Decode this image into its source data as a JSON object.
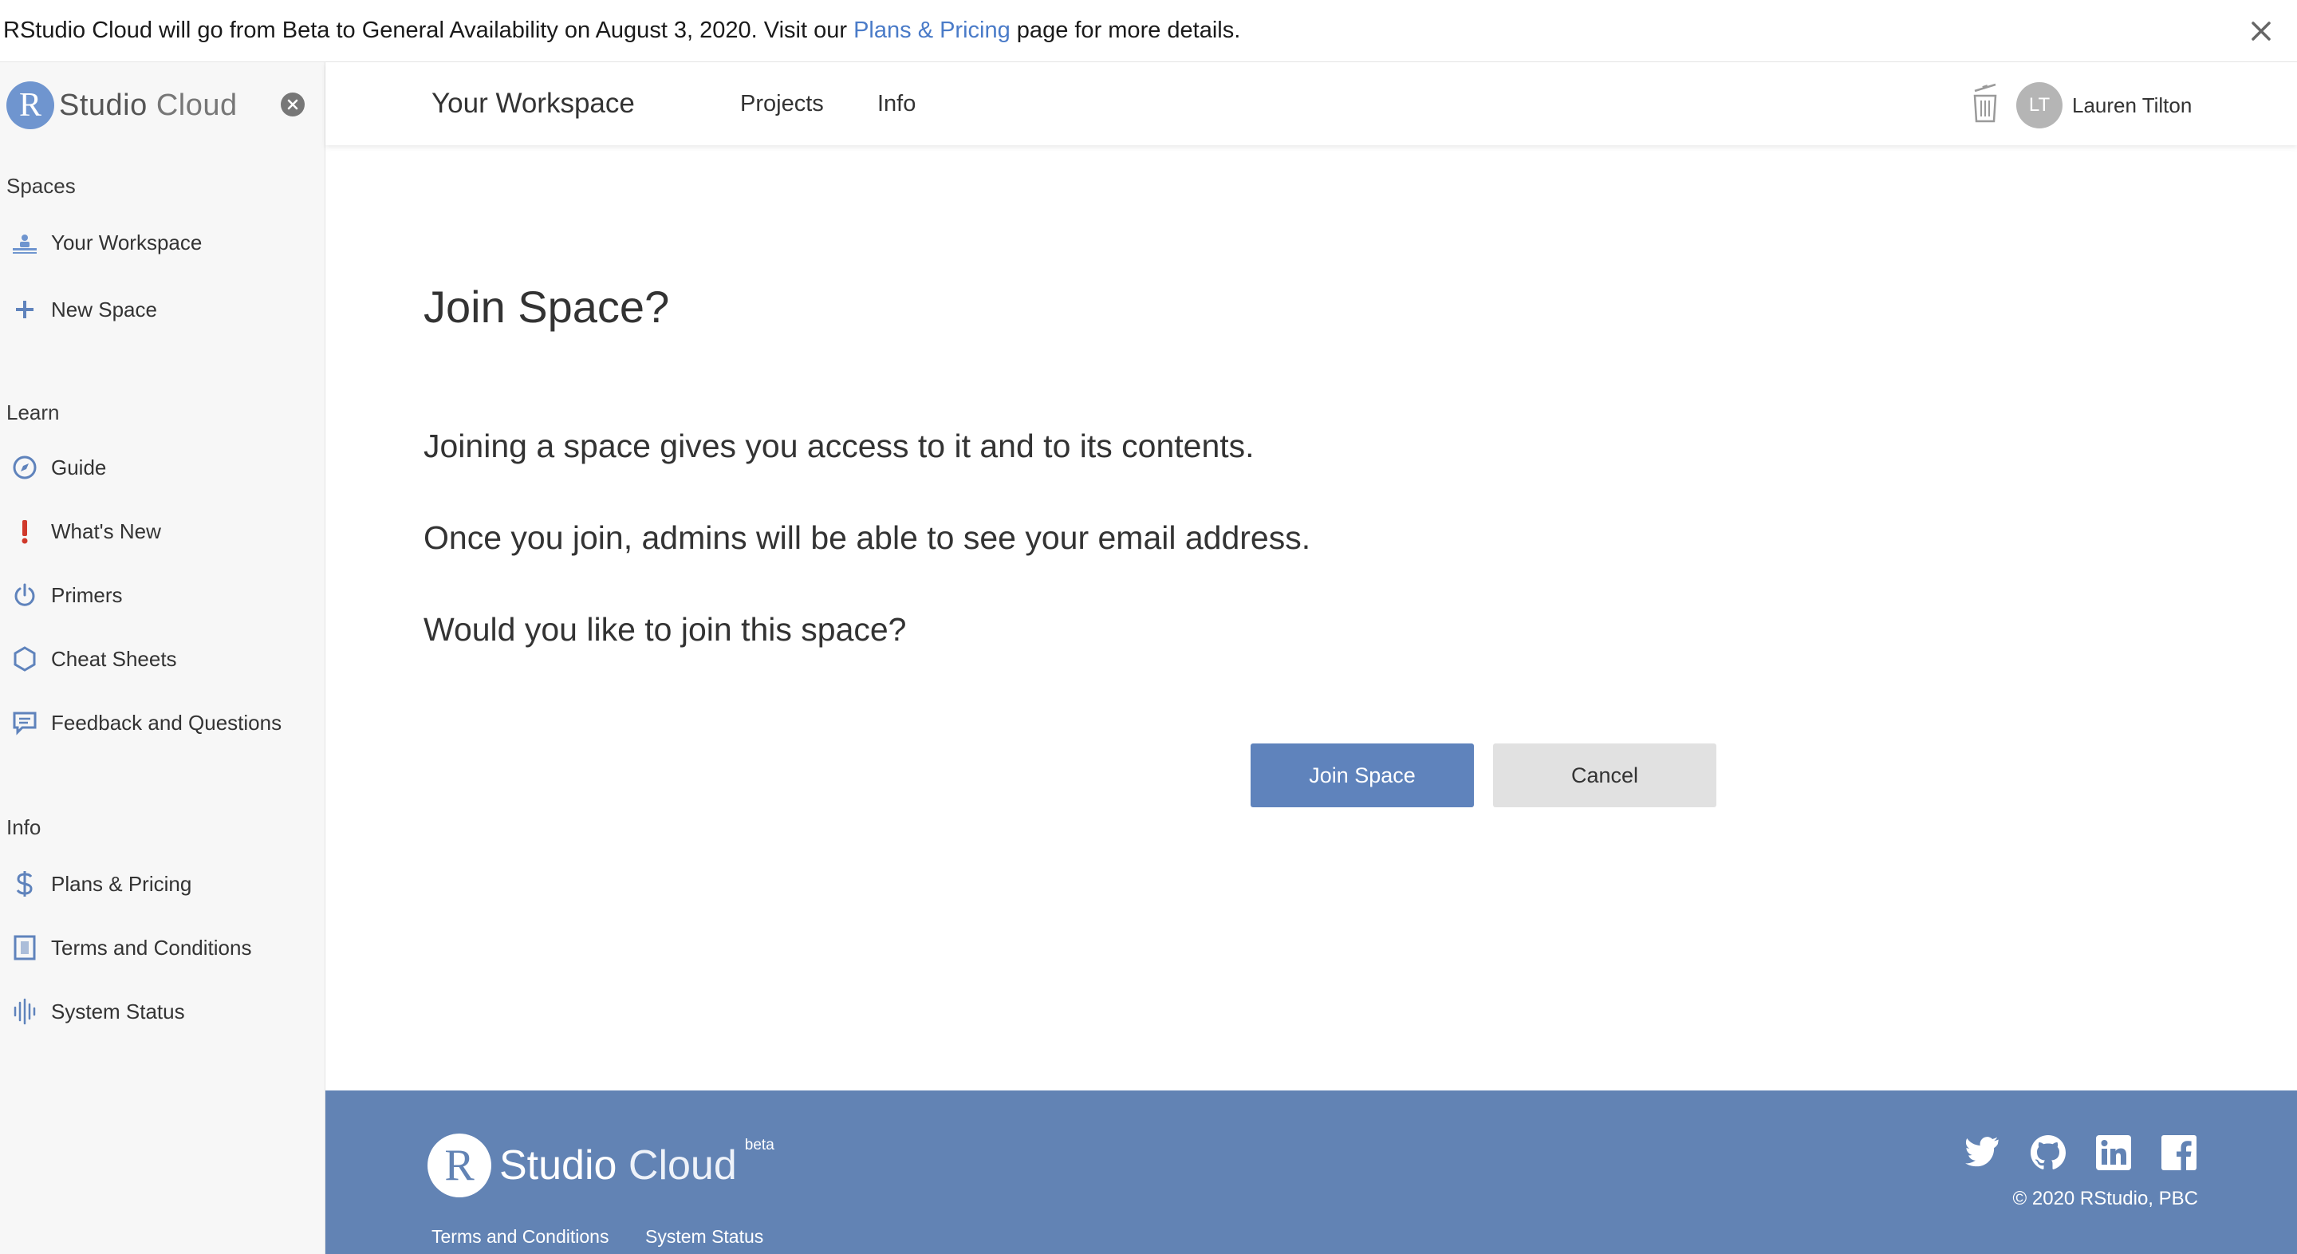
{
  "banner": {
    "text_before": "RStudio Cloud will go from Beta to General Availability on August 3, 2020. Visit our ",
    "link_text": "Plans & Pricing",
    "text_after": " page for more details."
  },
  "sidebar": {
    "logo": {
      "r": "R",
      "studio": "Studio",
      "cloud": "Cloud"
    },
    "sections": {
      "spaces": "Spaces",
      "learn": "Learn",
      "info": "Info"
    },
    "items": {
      "workspace": "Your Workspace",
      "new_space": "New Space",
      "guide": "Guide",
      "whats_new": "What's New",
      "primers": "Primers",
      "cheat_sheets": "Cheat Sheets",
      "feedback": "Feedback and Questions",
      "plans": "Plans & Pricing",
      "terms": "Terms and Conditions",
      "status": "System Status"
    }
  },
  "header": {
    "title": "Your Workspace",
    "tabs": {
      "projects": "Projects",
      "info": "Info"
    },
    "user": {
      "initials": "LT",
      "name": "Lauren Tilton"
    }
  },
  "main": {
    "title": "Join Space?",
    "p1": "Joining a space gives you access to it and to its contents.",
    "p2": "Once you join, admins will be able to see your email address.",
    "p3": "Would you like to join this space?",
    "join_label": "Join Space",
    "cancel_label": "Cancel"
  },
  "footer": {
    "logo": {
      "r": "R",
      "studio": "Studio",
      "cloud": "Cloud",
      "beta": "beta"
    },
    "links": {
      "terms": "Terms and Conditions",
      "status": "System Status"
    },
    "copyright": "© 2020 RStudio, PBC",
    "social_icons": [
      "twitter-icon",
      "github-icon",
      "linkedin-icon",
      "facebook-icon"
    ]
  },
  "colors": {
    "accent": "#5f83bc",
    "footer_bg": "#6283b4",
    "link": "#4a7bc8",
    "alert": "#d0392b"
  }
}
